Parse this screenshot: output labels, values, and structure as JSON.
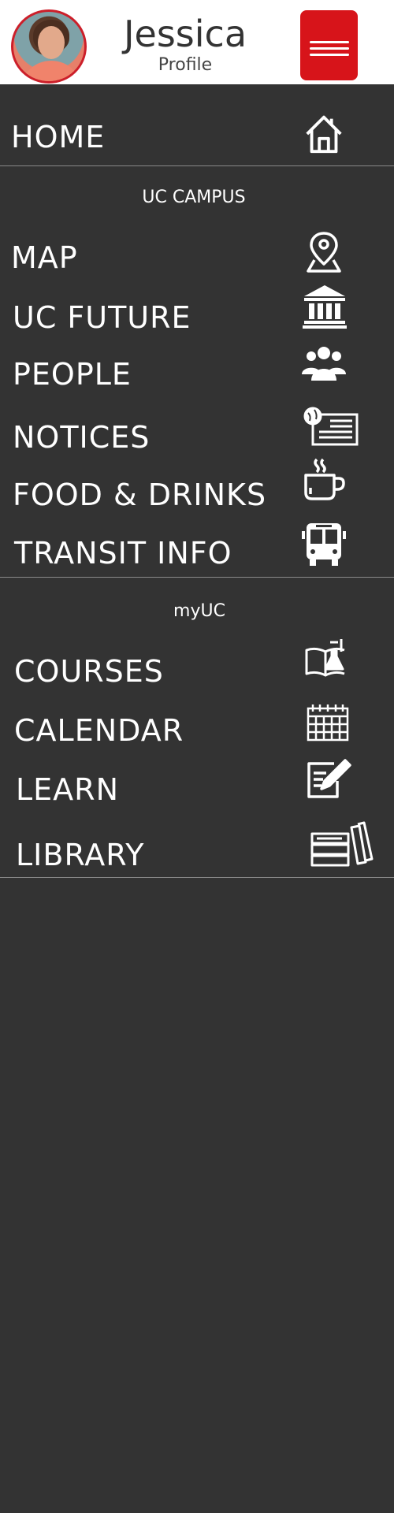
{
  "header": {
    "username": "Jessica",
    "role": "Profile"
  },
  "nav": {
    "home": "HOME",
    "campus_section": "UC CAMPUS",
    "campus_items": [
      "MAP",
      "UC FUTURE",
      "PEOPLE",
      "NOTICES",
      "FOOD & DRINKS",
      "TRANSIT INFO"
    ],
    "myuc_section": "myUC",
    "myuc_items": [
      "COURSES",
      "CALENDAR",
      "LEARN",
      "LIBRARY"
    ]
  },
  "icons": {
    "home": "house-icon",
    "map": "map-pin-icon",
    "future": "building-icon",
    "people": "people-icon",
    "notices": "newspaper-icon",
    "food": "coffee-cup-icon",
    "transit": "bus-icon",
    "courses": "book-flask-icon",
    "calendar": "calendar-icon",
    "learn": "notepad-pencil-icon",
    "library": "books-icon"
  },
  "colors": {
    "background": "#333333",
    "header": "#ffffff",
    "accent": "#d7141a",
    "text": "#ffffff"
  }
}
